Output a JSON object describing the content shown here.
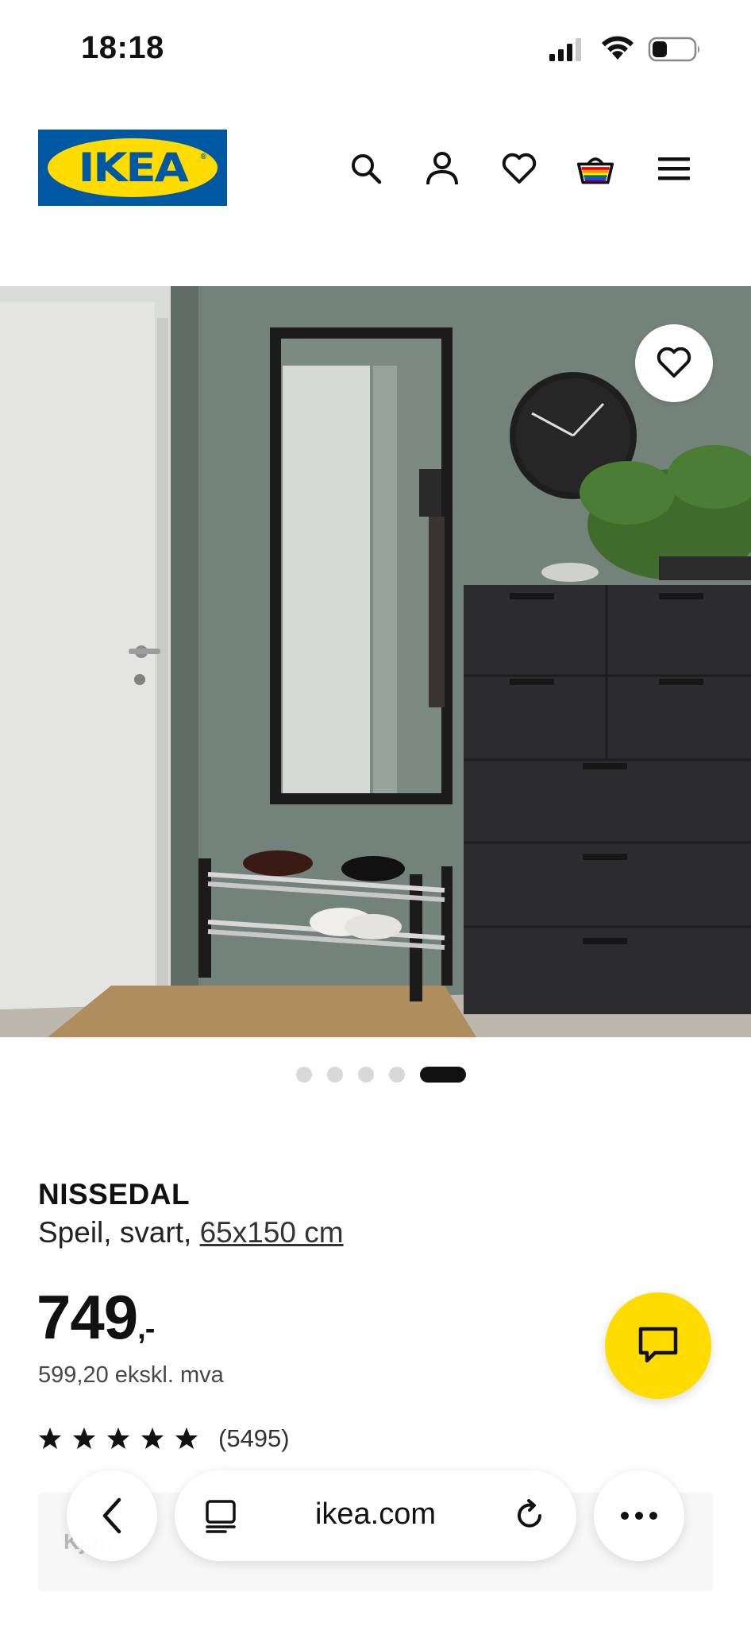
{
  "status_bar": {
    "time": "18:18"
  },
  "header": {
    "logo_text": "IKEA",
    "icons": [
      "search-icon",
      "account-icon",
      "heart-icon",
      "shopping-bag-icon",
      "menu-icon"
    ]
  },
  "gallery": {
    "image_count": 5,
    "active_index": 4
  },
  "product": {
    "name": "NISSEDAL",
    "description": "Speil, svart,",
    "size_link": "65x150 cm",
    "price_main": "749",
    "price_suffix": ",-",
    "price_ex_vat": "599,20 ekskl. mva",
    "rating_stars": 5,
    "rating_count": "(5495)"
  },
  "buy_box": {
    "label": "Kjøp"
  },
  "browser": {
    "url": "ikea.com"
  },
  "colors": {
    "brand_blue": "#0058a3",
    "brand_yellow": "#ffdb00"
  }
}
